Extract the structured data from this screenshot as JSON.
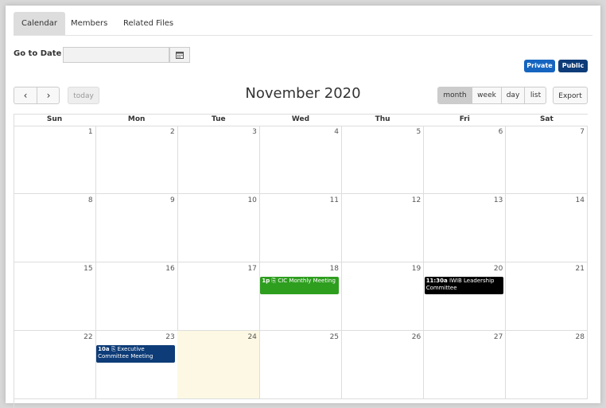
{
  "tabs": [
    "Calendar",
    "Members",
    "Related Files"
  ],
  "goto": {
    "label": "Go to Date",
    "value": ""
  },
  "visibility": {
    "private": "Private",
    "public": "Public"
  },
  "toolbar": {
    "prev_icon": "‹",
    "next_icon": "›",
    "today": "today",
    "title": "November 2020",
    "views": [
      "month",
      "week",
      "day",
      "list"
    ],
    "active_view": "month",
    "export": "Export"
  },
  "colors": {
    "primary": "#1565c0",
    "dark_blue": "#0d3c78",
    "green": "#2e9e1f",
    "today_bg": "#fcf8e3"
  },
  "weekdays": [
    "Sun",
    "Mon",
    "Tue",
    "Wed",
    "Thu",
    "Fri",
    "Sat"
  ],
  "weeks": [
    [
      "1",
      "2",
      "3",
      "4",
      "5",
      "6",
      "7"
    ],
    [
      "8",
      "9",
      "10",
      "11",
      "12",
      "13",
      "14"
    ],
    [
      "15",
      "16",
      "17",
      "18",
      "19",
      "20",
      "21"
    ],
    [
      "22",
      "23",
      "24",
      "25",
      "26",
      "27",
      "28"
    ]
  ],
  "today": "24",
  "events": [
    {
      "day": "18",
      "time": "1p",
      "title": "CIC Monthly Meeting",
      "color": "#2e9e1f",
      "attachment": true
    },
    {
      "day": "20",
      "time": "11:30a",
      "title": "IWIB Leadership Committee",
      "color": "#000000",
      "attachment": false
    },
    {
      "day": "23",
      "time": "10a",
      "title": "Executive Committee Meeting",
      "color": "#0d3c78",
      "attachment": true
    }
  ]
}
